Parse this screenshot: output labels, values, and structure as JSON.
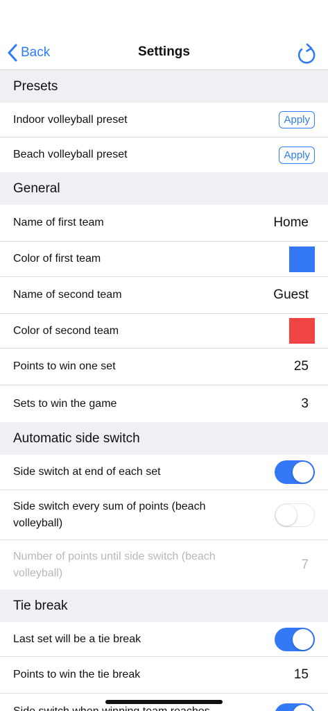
{
  "nav": {
    "back_label": "Back",
    "title": "Settings",
    "accent_color": "#2f7cf6"
  },
  "sections": {
    "presets": {
      "header": "Presets",
      "indoor_label": "Indoor volleyball preset",
      "beach_label": "Beach volleyball preset",
      "apply_label": "Apply"
    },
    "general": {
      "header": "General",
      "first_team_name_label": "Name of first team",
      "first_team_name": "Home",
      "first_team_color_label": "Color of first team",
      "first_team_color": "#3478f6",
      "second_team_name_label": "Name of second team",
      "second_team_name": "Guest",
      "second_team_color_label": "Color of second team",
      "second_team_color": "#f04444",
      "points_per_set_label": "Points to win one set",
      "points_per_set": "25",
      "sets_to_win_label": "Sets to win the game",
      "sets_to_win": "3"
    },
    "side_switch": {
      "header": "Automatic side switch",
      "end_of_set_label": "Side switch at end of each set",
      "end_of_set_on": true,
      "sum_points_label": "Side switch every sum of points (beach volleyball)",
      "sum_points_on": false,
      "points_until_label": "Number of points until side switch (beach volleyball)",
      "points_until": "7"
    },
    "tie_break": {
      "header": "Tie break",
      "last_set_label": "Last set will be a tie break",
      "last_set_on": true,
      "points_label": "Points to win the tie break",
      "points": "15",
      "switch_label": "Side switch when winning team reaches",
      "switch_on": true
    }
  }
}
